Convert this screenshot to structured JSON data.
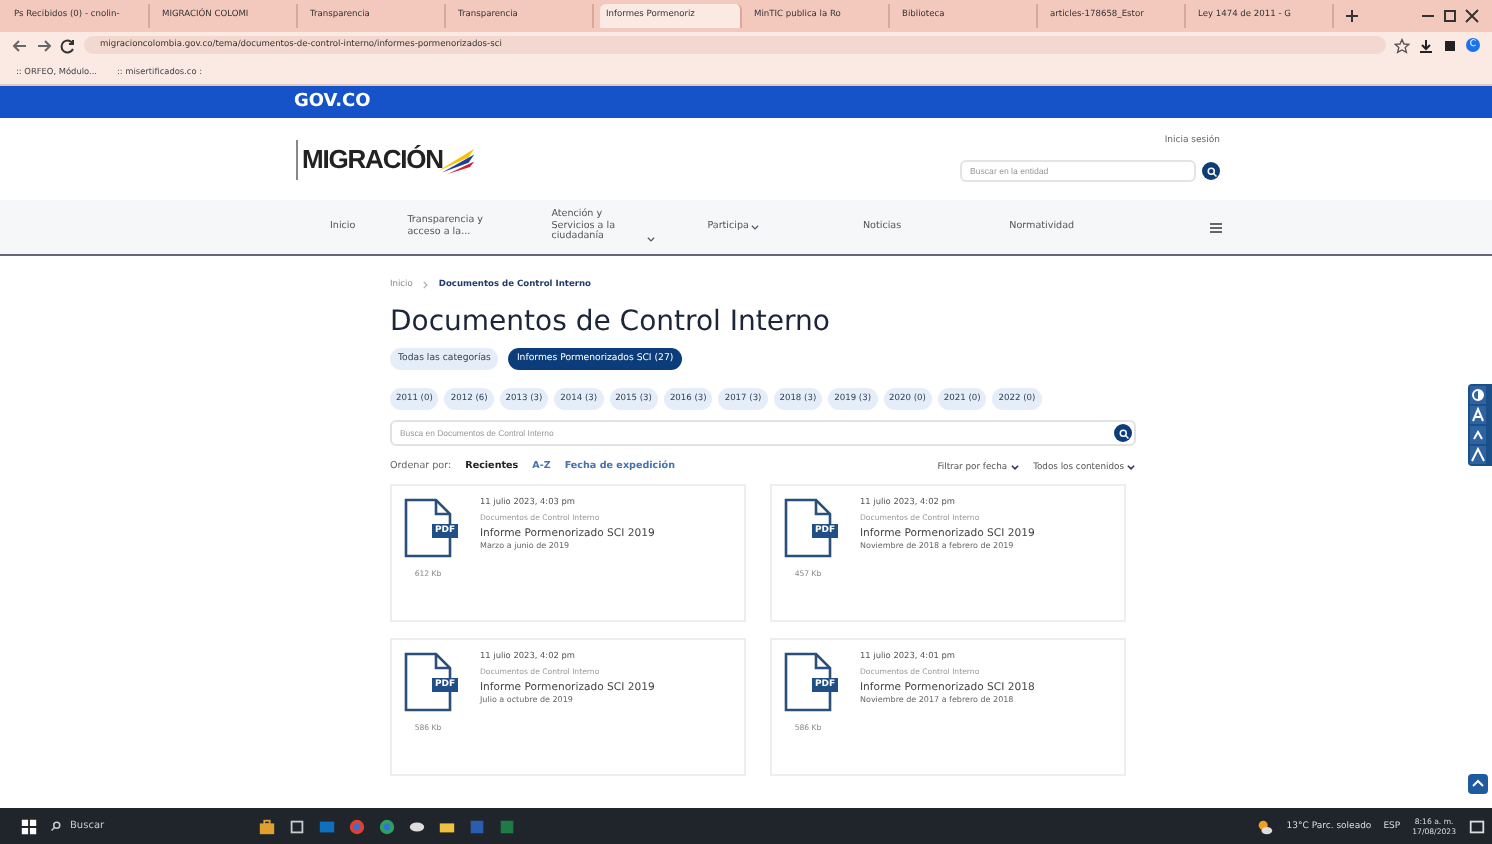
{
  "browser": {
    "tabs": [
      {
        "title": "Ps Recibidos (0) - cnolin-",
        "selected": false
      },
      {
        "title": "MIGRACIÓN COLOMI",
        "selected": false
      },
      {
        "title": "Transparencia",
        "selected": false
      },
      {
        "title": "Transparencia",
        "selected": false
      },
      {
        "title": "Informes Pormenoriz",
        "selected": true
      },
      {
        "title": "MinTIC publica la Ro",
        "selected": false
      },
      {
        "title": "Biblioteca",
        "selected": false
      },
      {
        "title": "articles-178658_Estor",
        "selected": false
      },
      {
        "title": "Ley 1474 de 2011 - G",
        "selected": false
      }
    ],
    "url": "migracioncolombia.gov.co/tema/documentos-de-control-interno/informes-pormenorizados-sci",
    "profile": "C",
    "bookmarks": [
      ":: ORFEO, Módulo...",
      ":: misertificados.co :"
    ]
  },
  "gov_bar": {
    "brand": "GOV.CO"
  },
  "header": {
    "logo": "MIGRACIÓN",
    "login": "Inicia sesión",
    "search": {
      "placeholder": "Buscar en la entidad"
    }
  },
  "nav": [
    {
      "label": "Inicio",
      "dropdown": false
    },
    {
      "label": "Transparencia y acceso a la...",
      "dropdown": false
    },
    {
      "label": "Atención y Servicios a la ciudadanía",
      "dropdown": true
    },
    {
      "label": "Participa",
      "dropdown": true
    },
    {
      "label": "Noticias",
      "dropdown": false
    },
    {
      "label": "Normatividad",
      "dropdown": false
    }
  ],
  "breadcrumb": [
    "Inicio",
    "Documentos de Control Interno"
  ],
  "title": "Documentos de Control Interno",
  "categories": [
    {
      "label": "Todas las categorías",
      "selected": false
    },
    {
      "label": "Informes Pormenorizados SCI (27)",
      "selected": true
    }
  ],
  "years": [
    "2011 (0)",
    "2012 (6)",
    "2013 (3)",
    "2014 (3)",
    "2015 (3)",
    "2016 (3)",
    "2017 (3)",
    "2018 (3)",
    "2019 (3)",
    "2020 (0)",
    "2021 (0)",
    "2022 (0)"
  ],
  "search": {
    "placeholder": "Busca en Documentos de Control Interno"
  },
  "sort": {
    "label": "Ordenar por:",
    "options": [
      {
        "label": "Recientes",
        "selected": true
      },
      {
        "label": "A-Z",
        "selected": false
      },
      {
        "label": "Fecha de expedición",
        "selected": false
      }
    ]
  },
  "filters": [
    "Filtrar por fecha",
    "Todos los contenidos"
  ],
  "cards": [
    {
      "badge": "PDF",
      "date": "11 julio 2023, 4:03 pm",
      "category": "Documentos de Control Interno",
      "title": "Informe Pormenorizado SCI 2019",
      "subtitle": "Marzo a junio de 2019",
      "size": "612 Kb"
    },
    {
      "badge": "PDF",
      "date": "11 julio 2023, 4:02 pm",
      "category": "Documentos de Control Interno",
      "title": "Informe Pormenorizado SCI 2019",
      "subtitle": "Noviembre de 2018 a febrero de 2019",
      "size": "457 Kb"
    },
    {
      "badge": "PDF",
      "date": "11 julio 2023, 4:02 pm",
      "category": "Documentos de Control Interno",
      "title": "Informe Pormenorizado SCI 2019",
      "subtitle": "Julio a octubre de 2019",
      "size": "586 Kb"
    },
    {
      "badge": "PDF",
      "date": "11 julio 2023, 4:01 pm",
      "category": "Documentos de Control Interno",
      "title": "Informe Pormenorizado SCI 2018",
      "subtitle": "Noviembre de 2017 a febrero de 2018",
      "size": "586 Kb"
    }
  ],
  "taskbar": {
    "search": "Buscar",
    "weather": "13°C Parc. soleado",
    "lang": "ESP",
    "time": "8:16 a. m.",
    "date": "17/08/2023"
  }
}
